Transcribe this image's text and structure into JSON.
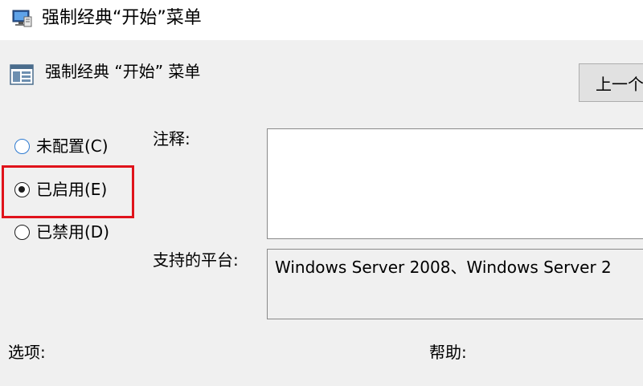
{
  "window": {
    "title": "强制经典“开始”菜单",
    "icon": "policy-computer-icon"
  },
  "header": {
    "title": "强制经典 “开始” 菜单",
    "icon": "policy-setting-icon"
  },
  "navigation": {
    "previous_label": "上一个"
  },
  "state_options": [
    {
      "label": "未配置(C)",
      "checked": false
    },
    {
      "label": "已启用(E)",
      "checked": true
    },
    {
      "label": "已禁用(D)",
      "checked": false
    }
  ],
  "highlight": {
    "color": "#e0131b",
    "target": "已启用(E)"
  },
  "comment": {
    "label": "注释:",
    "value": ""
  },
  "supported_on": {
    "label": "支持的平台:",
    "value": "Windows Server 2008、Windows Server 2"
  },
  "footer": {
    "options_label": "选项:",
    "help_label": "帮助:"
  }
}
